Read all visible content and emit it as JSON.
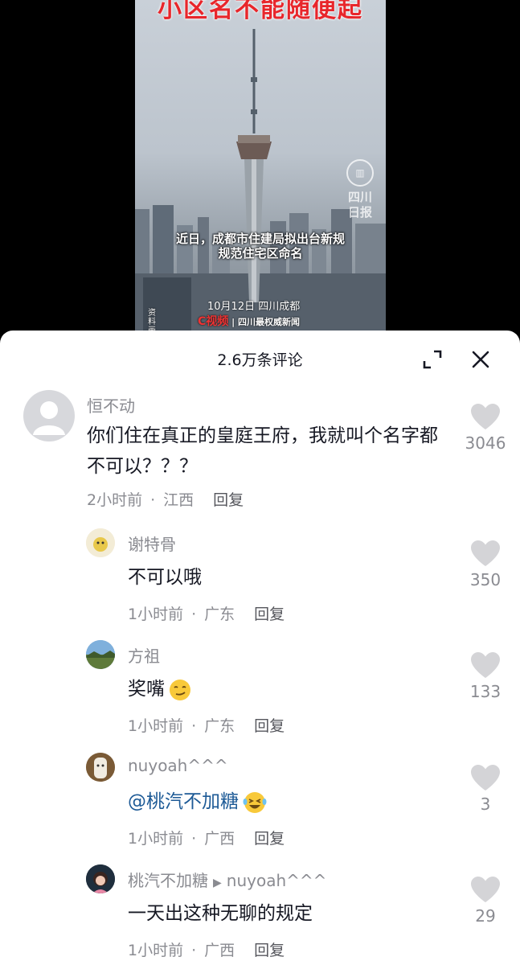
{
  "video": {
    "headline": "小区名不能随便起",
    "watermark_line1": "四川",
    "watermark_line2": "日报",
    "subtitle_line1": "近日，成都市住建局拟出台新规",
    "subtitle_line2": "规范住宅区命名",
    "dateline": "10月12日 四川成都",
    "source_tag": "资料画",
    "logo_c": "C视频",
    "logo_text": "| 四川最权威新闻"
  },
  "sheet": {
    "title": "2.6万条评论"
  },
  "comments": [
    {
      "username": "恒不动",
      "text": "你们住在真正的皇庭王府，我就叫个名字都不可以？？？",
      "time": "2小时前",
      "location": "江西",
      "reply": "回复",
      "likes": "3046"
    },
    {
      "username": "谢特骨",
      "text": "不可以哦",
      "time": "1小时前",
      "location": "广东",
      "reply": "回复",
      "likes": "350"
    },
    {
      "username": "方祖",
      "text": "奖嘴",
      "time": "1小时前",
      "location": "广东",
      "reply": "回复",
      "likes": "133"
    },
    {
      "username": "nuyoah^^^",
      "text": "@桃汽不加糖",
      "time": "1小时前",
      "location": "广西",
      "reply": "回复",
      "likes": "3"
    },
    {
      "username": "桃汽不加糖",
      "reply_to": "nuyoah^^^",
      "text": "一天出这种无聊的规定",
      "time": "1小时前",
      "location": "广西",
      "reply": "回复",
      "likes": "29"
    }
  ],
  "meta_separator": "·",
  "colors": {
    "primary_text": "#161823",
    "secondary_text": "#8a8b91",
    "mention": "#1d5a96",
    "headline_red": "#e8262b"
  }
}
